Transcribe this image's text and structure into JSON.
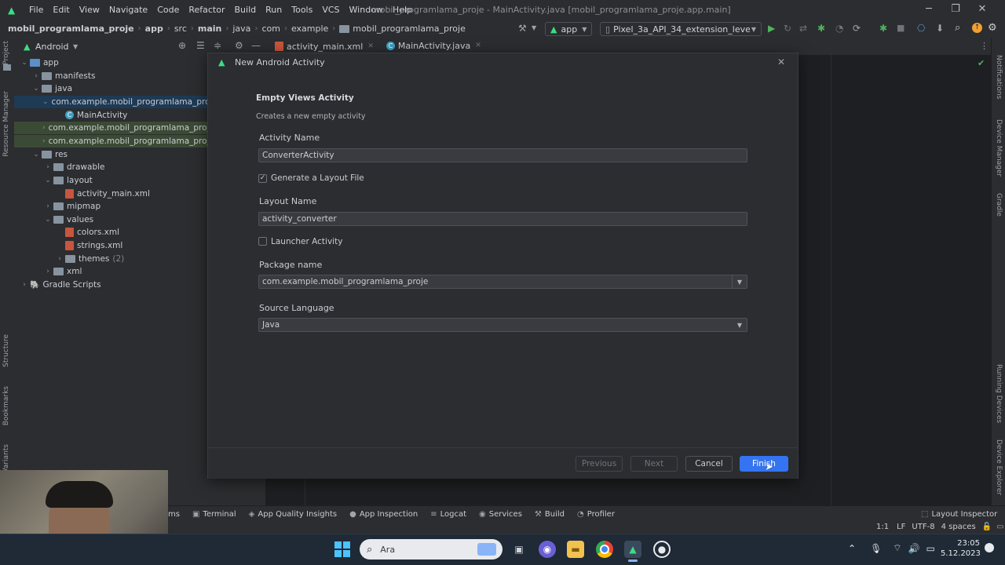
{
  "window": {
    "menu": [
      "File",
      "Edit",
      "View",
      "Navigate",
      "Code",
      "Refactor",
      "Build",
      "Run",
      "Tools",
      "VCS",
      "Window",
      "Help"
    ],
    "title": "mobil_programlama_proje - MainActivity.java [mobil_programlama_proje.app.main]"
  },
  "breadcrumbs": [
    "mobil_programlama_proje",
    "app",
    "src",
    "main",
    "java",
    "com",
    "example",
    "mobil_programlama_proje"
  ],
  "toolbar": {
    "run_config": "app",
    "device": "Pixel_3a_API_34_extension_level_7_x86"
  },
  "left_strip": {
    "top": [
      "Project",
      "Resource Manager"
    ],
    "bottom": [
      "Structure",
      "Bookmarks",
      "Variants"
    ]
  },
  "right_strip": [
    "Notifications",
    "Device Manager",
    "Gradle",
    "Running Devices",
    "Device Explorer"
  ],
  "project_panel": {
    "view": "Android",
    "tree": [
      {
        "label": "app",
        "level": 0,
        "arrow": "v",
        "icon": "folder-blue"
      },
      {
        "label": "manifests",
        "level": 1,
        "arrow": ">",
        "icon": "folder"
      },
      {
        "label": "java",
        "level": 1,
        "arrow": "v",
        "icon": "folder"
      },
      {
        "label": "com.example.mobil_programlama_proje",
        "level": 2,
        "arrow": "v",
        "icon": "folder",
        "state": "selected"
      },
      {
        "label": "MainActivity",
        "level": 3,
        "arrow": "",
        "icon": "class"
      },
      {
        "label": "com.example.mobil_programlama_proje",
        "level": 2,
        "arrow": ">",
        "icon": "folder",
        "state": "green"
      },
      {
        "label": "com.example.mobil_programlama_proje",
        "level": 2,
        "arrow": ">",
        "icon": "folder",
        "state": "green"
      },
      {
        "label": "res",
        "level": 1,
        "arrow": "v",
        "icon": "folder"
      },
      {
        "label": "drawable",
        "level": 2,
        "arrow": ">",
        "icon": "folder"
      },
      {
        "label": "layout",
        "level": 2,
        "arrow": "v",
        "icon": "folder"
      },
      {
        "label": "activity_main.xml",
        "level": 3,
        "arrow": "",
        "icon": "xml"
      },
      {
        "label": "mipmap",
        "level": 2,
        "arrow": ">",
        "icon": "folder"
      },
      {
        "label": "values",
        "level": 2,
        "arrow": "v",
        "icon": "folder"
      },
      {
        "label": "colors.xml",
        "level": 3,
        "arrow": "",
        "icon": "xml"
      },
      {
        "label": "strings.xml",
        "level": 3,
        "arrow": "",
        "icon": "xml"
      },
      {
        "label": "themes",
        "level": 3,
        "arrow": ">",
        "icon": "folder",
        "suffix": "(2)"
      },
      {
        "label": "xml",
        "level": 2,
        "arrow": ">",
        "icon": "folder"
      },
      {
        "label": "Gradle Scripts",
        "level": 0,
        "arrow": ">",
        "icon": "gradle"
      }
    ]
  },
  "editor_tabs": [
    {
      "label": "activity_main.xml",
      "active": false
    },
    {
      "label": "MainActivity.java",
      "active": true
    }
  ],
  "dialog": {
    "title": "New Android Activity",
    "heading": "Empty Views Activity",
    "subheading": "Creates a new empty activity",
    "activity_name_label": "Activity Name",
    "activity_name_value": "ConverterActivity",
    "generate_layout_label": "Generate a Layout File",
    "generate_layout_checked": true,
    "layout_name_label": "Layout Name",
    "layout_name_value": "activity_converter",
    "launcher_label": "Launcher Activity",
    "launcher_checked": false,
    "package_label": "Package name",
    "package_value": "com.example.mobil_programlama_proje",
    "language_label": "Source Language",
    "language_value": "Java",
    "buttons": {
      "previous": "Previous",
      "next": "Next",
      "cancel": "Cancel",
      "finish": "Finish"
    }
  },
  "bottom_tools": [
    "ms",
    "Terminal",
    "App Quality Insights",
    "App Inspection",
    "Logcat",
    "Services",
    "Build",
    "Profiler"
  ],
  "bottom_right_tool": "Layout Inspector",
  "status": {
    "position": "1:1",
    "line_sep": "LF",
    "encoding": "UTF-8",
    "indent": "4 spaces"
  },
  "taskbar": {
    "search_placeholder": "Ara",
    "time": "23:05",
    "date": "5.12.2023"
  },
  "colors": {
    "accent": "#3574f0",
    "android_green": "#3ddc84",
    "bg": "#2b2d30",
    "editor_bg": "#1e1f22"
  }
}
